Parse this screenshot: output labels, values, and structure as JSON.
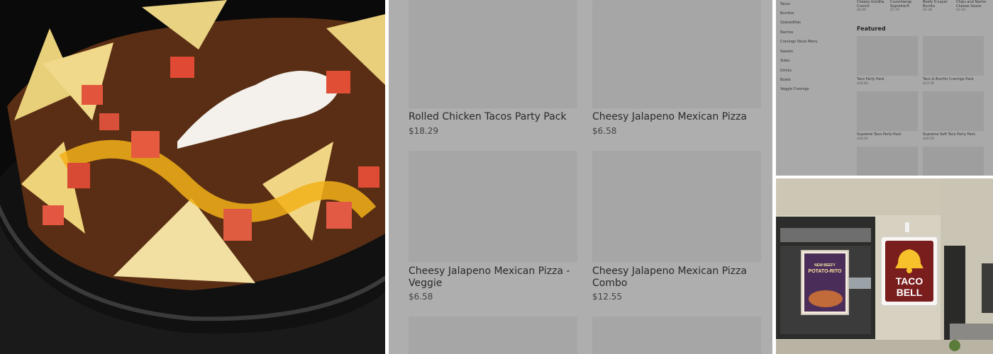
{
  "menu_grid": {
    "items": [
      {
        "name": "Rolled Chicken Tacos Party Pack",
        "price": "$18.29"
      },
      {
        "name": "Cheesy Jalapeno Mexican Pizza",
        "price": "$6.58"
      },
      {
        "name": "Cheesy Jalapeno Mexican Pizza - Veggie",
        "price": "$6.58"
      },
      {
        "name": "Cheesy Jalapeno Mexican Pizza Combo",
        "price": "$12.55"
      }
    ]
  },
  "menu_page": {
    "sidebar": [
      "Tacos",
      "Burritos",
      "Quesadillas",
      "Nachos",
      "Cravings Value Menu",
      "Sweets",
      "Sides",
      "Drinks",
      "Bowls",
      "Veggie Cravings"
    ],
    "top_row": [
      {
        "name": "Cheesy Gordita Crunch",
        "price": "$6.09"
      },
      {
        "name": "Crunchwrap Supreme®",
        "price": "$7.19"
      },
      {
        "name": "Beefy 5-Layer Burrito",
        "price": "$5.38"
      },
      {
        "name": "Chips and Nacho Cheese Sauce",
        "price": "$3.18"
      }
    ],
    "featured_title": "Featured",
    "featured": [
      {
        "name": "Taco Party Pack",
        "price": "$29.83"
      },
      {
        "name": "Taco & Burrito Cravings Pack",
        "price": "$23.78"
      },
      {
        "name": "Supreme Taco Party Pack",
        "price": "$39.59"
      },
      {
        "name": "Supreme Soft Taco Party Pack",
        "price": "$39.59"
      }
    ]
  },
  "storefront": {
    "sign_line1": "TACO",
    "sign_line2": "BELL",
    "poster_line1": "NEW BEEFY",
    "poster_line2": "POTATO-RITO"
  }
}
